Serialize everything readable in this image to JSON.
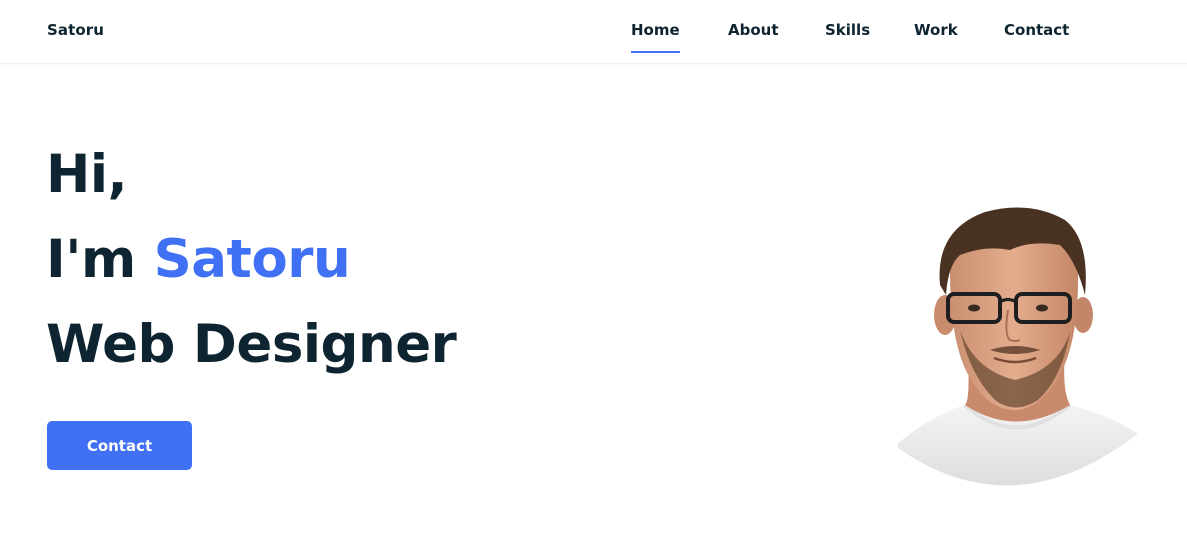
{
  "header": {
    "logo": "Satoru",
    "nav": [
      {
        "label": "Home",
        "active": true
      },
      {
        "label": "About",
        "active": false
      },
      {
        "label": "Skills",
        "active": false
      },
      {
        "label": "Work",
        "active": false
      },
      {
        "label": "Contact",
        "active": false
      }
    ]
  },
  "hero": {
    "greeting": "Hi,",
    "intro_prefix": "I'm",
    "name": "Satoru",
    "role": "Web Designer",
    "cta_label": "Contact"
  },
  "colors": {
    "accent": "#4070f4",
    "text": "#0e2431",
    "background": "#ffffff"
  }
}
